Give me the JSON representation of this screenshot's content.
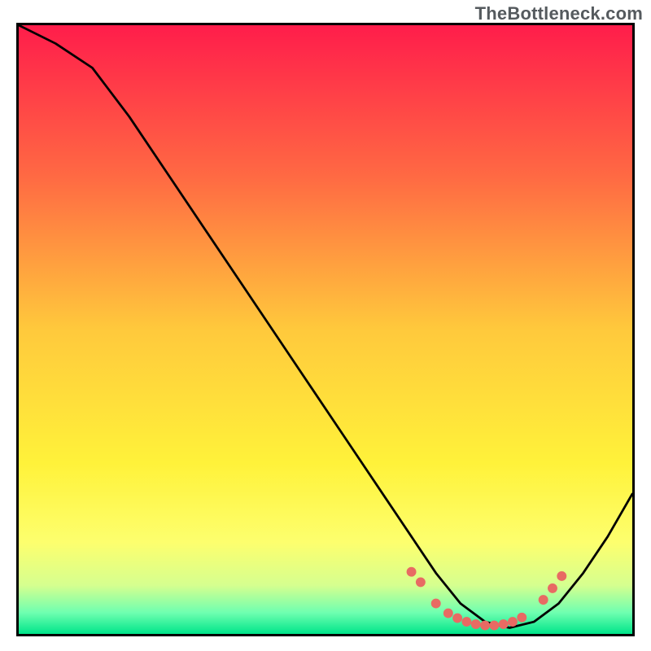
{
  "watermark": "TheBottleneck.com",
  "chart_data": {
    "type": "line",
    "title": "",
    "xlabel": "",
    "ylabel": "",
    "xlim": [
      0,
      100
    ],
    "ylim": [
      0,
      100
    ],
    "background": {
      "type": "vertical-gradient",
      "stops": [
        {
          "pos": 0.0,
          "color": "#ff1d4b"
        },
        {
          "pos": 0.25,
          "color": "#ff6a43"
        },
        {
          "pos": 0.5,
          "color": "#ffc93c"
        },
        {
          "pos": 0.72,
          "color": "#fff23a"
        },
        {
          "pos": 0.85,
          "color": "#fdff6e"
        },
        {
          "pos": 0.92,
          "color": "#d6ff8f"
        },
        {
          "pos": 0.965,
          "color": "#6fffb0"
        },
        {
          "pos": 1.0,
          "color": "#00e58a"
        }
      ]
    },
    "series": [
      {
        "name": "bottleneck-curve",
        "color": "#000000",
        "x": [
          0,
          6,
          12,
          18,
          24,
          30,
          36,
          42,
          48,
          54,
          60,
          64,
          68,
          72,
          76,
          80,
          84,
          88,
          92,
          96,
          100
        ],
        "y": [
          100,
          97,
          93,
          85,
          76,
          67,
          58,
          49,
          40,
          31,
          22,
          16,
          10,
          5,
          2,
          1,
          2,
          5,
          10,
          16,
          23
        ]
      }
    ],
    "markers": {
      "name": "optimal-range-dots",
      "color": "#e86a63",
      "radius": 6,
      "x": [
        64,
        65.5,
        68,
        70,
        71.5,
        73,
        74.5,
        76,
        77.5,
        79,
        80.5,
        82,
        85.5,
        87,
        88.5
      ],
      "y": [
        10.2,
        8.5,
        5,
        3.4,
        2.6,
        2.0,
        1.6,
        1.4,
        1.4,
        1.6,
        2.0,
        2.7,
        5.6,
        7.5,
        9.5
      ]
    }
  }
}
